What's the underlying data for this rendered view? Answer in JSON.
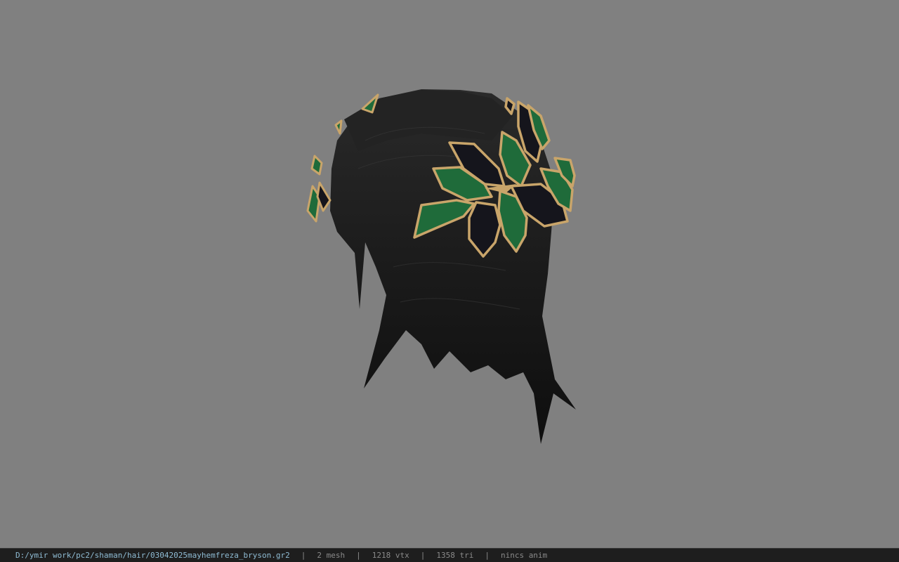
{
  "viewer": {
    "background_color": "#808080",
    "model_icon": "hair-model-with-leaf-crown"
  },
  "status": {
    "file_path": "D:/ymir work/pc2/shaman/hair/03042025mayhemfreza_bryson.gr2",
    "separator": "|",
    "mesh_count": "2 mesh",
    "vertex_count": "1218 vtx",
    "triangle_count": "1358 tri",
    "animation": "nincs anim"
  },
  "colors": {
    "hair": "#1b1b1b",
    "leaf_green": "#1f6b3a",
    "leaf_black": "#15151c",
    "leaf_rim": "#c9a56a",
    "status_bg": "#1e1e1e",
    "path_text": "#8fbcd4"
  }
}
